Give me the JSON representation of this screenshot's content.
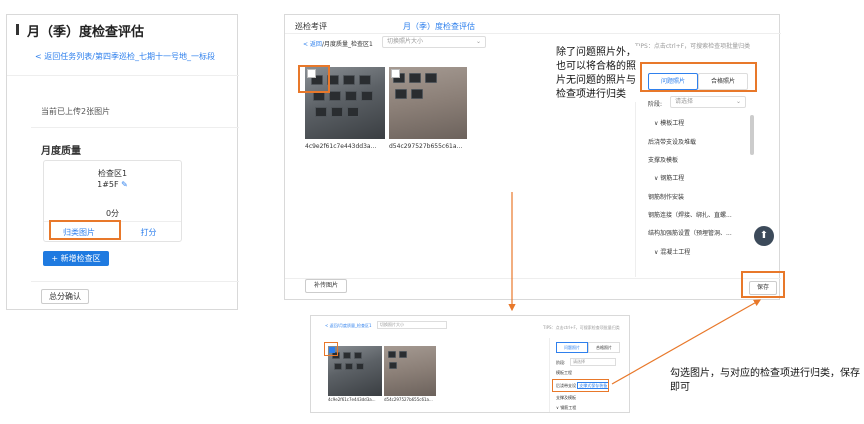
{
  "left": {
    "title": "月（季）度检查评估",
    "breadcrumb_back": "< 返回任务列表",
    "breadcrumb_rest": "/第四季巡检_七期十一号地_一标段",
    "uploaded_note": "当前已上传2张图片",
    "section_title": "月度质量",
    "card_line1": "检查区1",
    "card_line2": "1#5F",
    "card_score": "0分",
    "card_btn_classify": "归类图片",
    "card_btn_score": "打分",
    "add_button": "+ 新增检查区",
    "confirm_button": "总分确认"
  },
  "main": {
    "tab1": "巡检考评",
    "tab2": "月（季）度检查评估",
    "breadcrumb_back": "< 返回",
    "breadcrumb_rest": "/月度质量_检查区1",
    "size_select_placeholder": "切换照片大小",
    "tips": "TIPS：点击ctrl+F，可搜索检查项批量归类",
    "photo1_name": "4c9e2f61c7e443dd3a...",
    "photo2_name": "d54c297527b655c61a...",
    "side_tab1": "问题照片",
    "side_tab2": "合格照片",
    "stage_label": "阶段:",
    "stage_placeholder": "请选择",
    "side_items": [
      "∨ 模板工程",
      "后浇带支设及堆载",
      "支撑及模板",
      "∨ 钢筋工程",
      "钢筋制作安装",
      "钢筋连接（焊接、绑扎、直螺...",
      "结构加强筋设置（预埋管洞、...",
      "∨ 混凝土工程"
    ],
    "upload_button": "补传图片",
    "save_button": "保存"
  },
  "callout_top": "除了问题照片外，也可以将合格的照片无问题的照片与检查项进行归类",
  "callout_bottom": "勾选图片，与对应的检查项进行归类，保存即可",
  "mini": {
    "breadcrumb": "< 返回/月度质量_检查区1",
    "select": "切换照片大小",
    "tips": "TIPS：点击ctrl+F，可搜索检查项批量归类",
    "photo1_name": "4c9e2f61c7e443dd3a...",
    "photo2_name": "d54c297527b655c61a...",
    "side_tab1": "问题照片",
    "side_tab2": "合格照片",
    "stage_label": "阶段:",
    "stage_placeholder": "请选择",
    "item1": "模板工程",
    "item2_prefix": "后浇带支设",
    "item2_tag": "支撑式保存装备",
    "item3": "支撑及模板",
    "item4": "∨ 钢筋工程"
  },
  "colors": {
    "accent": "#2f80ed",
    "callout": "#e8782a",
    "primary_btn": "#1f7ae0"
  }
}
